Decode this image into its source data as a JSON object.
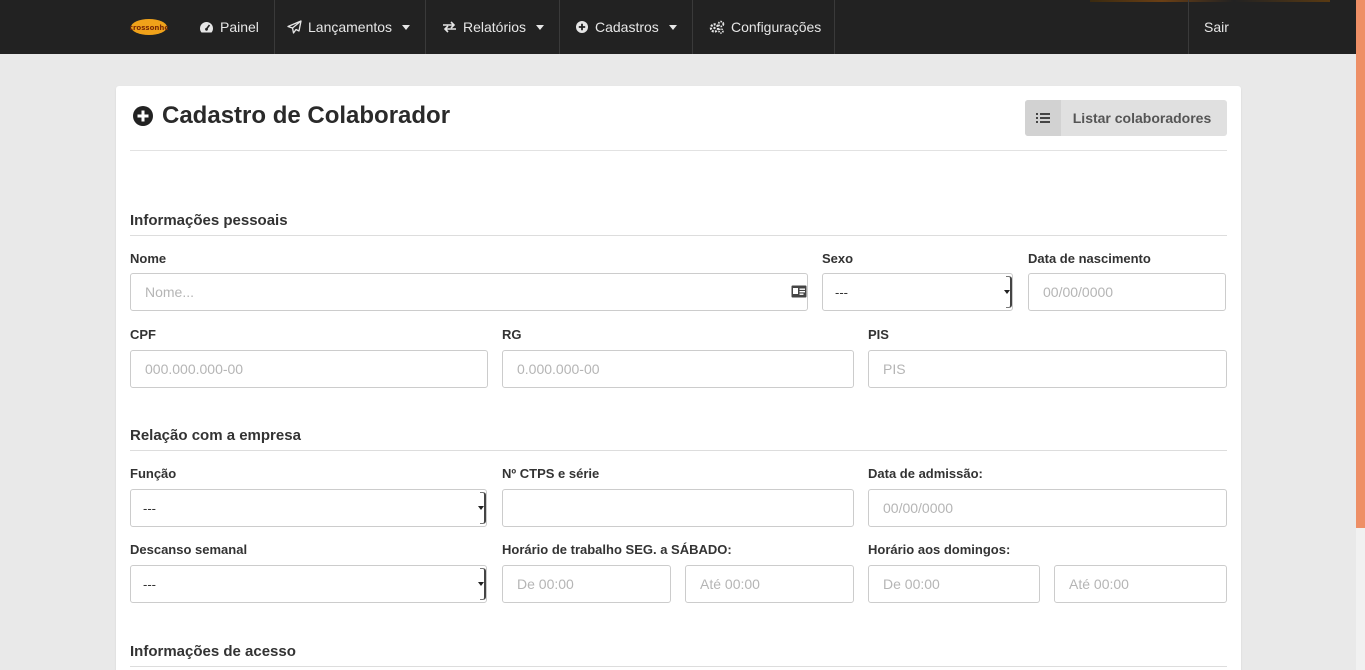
{
  "app": {
    "logo_text": "crossonho"
  },
  "navbar": {
    "items": [
      {
        "label": "Painel",
        "icon": "dashboard-icon",
        "caret": false
      },
      {
        "label": "Lançamentos",
        "icon": "paper-plane-icon",
        "caret": true
      },
      {
        "label": "Relatórios",
        "icon": "exchange-icon",
        "caret": true
      },
      {
        "label": "Cadastros",
        "icon": "plus-circle-icon",
        "caret": true
      },
      {
        "label": "Configurações",
        "icon": "gears-icon",
        "caret": false
      }
    ],
    "logout_label": "Sair"
  },
  "page": {
    "title": "Cadastro de Colaborador",
    "list_button_label": "Listar colaboradores"
  },
  "sections": {
    "personal": "Informações pessoais",
    "company": "Relação com a empresa",
    "access": "Informações de acesso"
  },
  "fields": {
    "nome": {
      "label": "Nome",
      "placeholder": "Nome...",
      "value": ""
    },
    "sexo": {
      "label": "Sexo",
      "selected": "---"
    },
    "nascimento": {
      "label": "Data de nascimento",
      "placeholder": "00/00/0000",
      "value": ""
    },
    "cpf": {
      "label": "CPF",
      "placeholder": "000.000.000-00",
      "value": ""
    },
    "rg": {
      "label": "RG",
      "placeholder": "0.000.000-00",
      "value": ""
    },
    "pis": {
      "label": "PIS",
      "placeholder": "PIS",
      "value": ""
    },
    "funcao": {
      "label": "Função",
      "selected": "---"
    },
    "ctps": {
      "label": "Nº CTPS e série",
      "placeholder": "",
      "value": ""
    },
    "admissao": {
      "label": "Data de admissão:",
      "placeholder": "00/00/0000",
      "value": ""
    },
    "descanso": {
      "label": "Descanso semanal",
      "selected": "---"
    },
    "horario_semana": {
      "label": "Horário de trabalho SEG. a SÁBADO:",
      "de_placeholder": "De 00:00",
      "ate_placeholder": "Até 00:00"
    },
    "horario_domingo": {
      "label": "Horário aos domingos:",
      "de_placeholder": "De 00:00",
      "ate_placeholder": "Até 00:00"
    }
  },
  "colors": {
    "navbar_bg": "#222222",
    "scroll_thumb": "#ee8f66",
    "page_bg": "#e9e9e9"
  }
}
